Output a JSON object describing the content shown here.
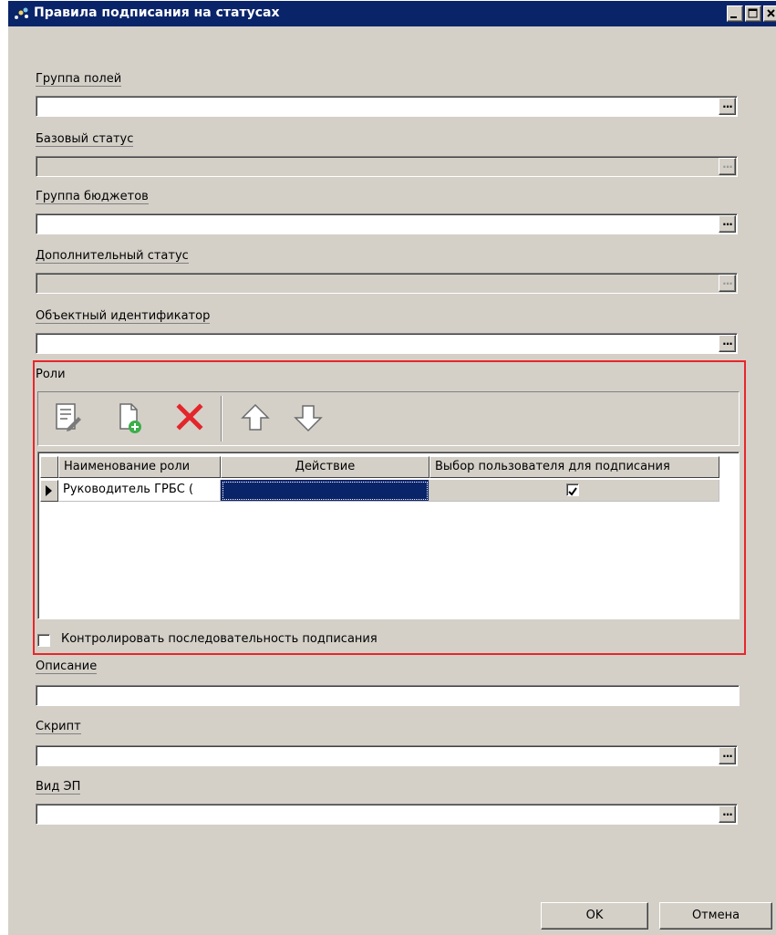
{
  "window": {
    "title": "Правила подписания на статусах"
  },
  "fields": {
    "field_group": {
      "label": "Группа полей",
      "value": ""
    },
    "base_status": {
      "label": "Базовый статус",
      "value": ""
    },
    "budget_group": {
      "label": "Группа бюджетов",
      "value": ""
    },
    "additional_status": {
      "label": "Дополнительный статус",
      "value": ""
    },
    "object_id": {
      "label": "Объектный идентификатор",
      "value": ""
    }
  },
  "ellipsis": "...",
  "roles": {
    "label": "Роли",
    "toolbar": [
      "edit-icon",
      "add-document-icon",
      "delete-icon",
      "move-up-icon",
      "move-down-icon"
    ],
    "columns": [
      "Наименование роли",
      "Действие",
      "Выбор пользователя для подписания"
    ],
    "rows": [
      {
        "role_name": "Руководитель ГРБС (",
        "action": "",
        "select_user": true
      }
    ],
    "control_sequence_label": "Контролировать последовательность подписания",
    "control_sequence_checked": false
  },
  "description": {
    "label": "Описание",
    "value": ""
  },
  "script": {
    "label": "Скрипт",
    "value": ""
  },
  "ep_type": {
    "label": "Вид ЭП",
    "value": ""
  },
  "buttons": {
    "ok": "OK",
    "cancel": "Отмена"
  },
  "colors": {
    "title_bar": "#0a246a",
    "highlight_frame": "#e8262a",
    "selected_cell": "#0a246a"
  }
}
